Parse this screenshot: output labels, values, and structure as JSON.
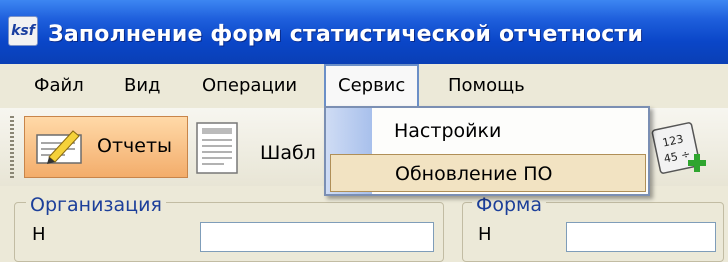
{
  "window": {
    "title": "Заполнение форм статистической отчетности",
    "app_icon": "app-icon"
  },
  "menu": {
    "items": [
      {
        "label": "Файл"
      },
      {
        "label": "Вид"
      },
      {
        "label": "Операции"
      },
      {
        "label": "Сервис"
      },
      {
        "label": "Помощь"
      }
    ],
    "active_item": "Сервис"
  },
  "toolbar": {
    "reports_label": "Отчеты",
    "templates_label": "Шабл",
    "reports_icon": "form-pencil-icon",
    "templates_icon": "document-template-icon",
    "calculator_icon": "calculator-add-icon"
  },
  "dropdown": {
    "items": [
      {
        "label": "Настройки"
      },
      {
        "label": "Обновление ПО"
      }
    ],
    "highlighted": "Обновление ПО"
  },
  "panels": {
    "organization_label": "Организация",
    "form_label": "Форма",
    "field_label_1": "Н",
    "field_label_2": "Н"
  },
  "colors": {
    "titlebar": "#0a46c8",
    "reports_button": "#f3ad6b",
    "menu_highlight": "#f2e3c2",
    "group_label": "#1c3f9a"
  }
}
